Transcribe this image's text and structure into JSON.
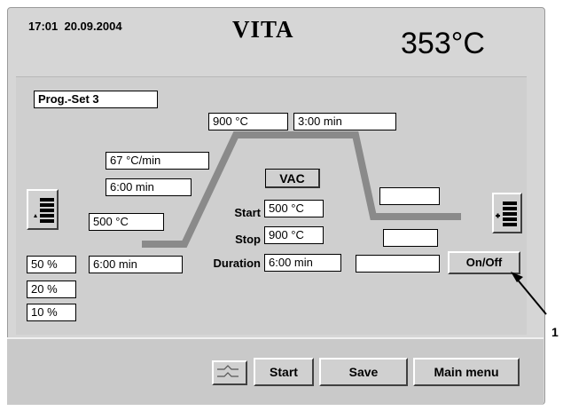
{
  "header": {
    "clock": "17:01",
    "date": "20.09.2004",
    "brand": "VITA",
    "current_temperature": "353°C"
  },
  "program": {
    "set_label": "Prog.-Set 3",
    "top_temperature": "900 °C",
    "hold_time": "3:00 min",
    "heat_rate": "67 °C/min",
    "heat_time": "6:00 min",
    "start_temperature": "500 °C",
    "predry_time": "6:00 min",
    "cool_box_1": "",
    "cool_box_2": "",
    "cool_box_3": "",
    "percent_options": [
      "50 %",
      "20 %",
      "10 %"
    ]
  },
  "vacuum": {
    "button_label": "VAC",
    "start_label": "Start",
    "start_value": "500 °C",
    "stop_label": "Stop",
    "stop_value": "900 °C",
    "duration_label": "Duration",
    "duration_value": "6:00 min"
  },
  "onoff_label": "On/Off",
  "callout_number": "1",
  "footer": {
    "start_label": "Start",
    "save_label": "Save",
    "main_menu_label": "Main menu"
  },
  "icons": [
    "lift-down-icon",
    "lift-up-icon",
    "cooling-icon"
  ],
  "colors": {
    "background": "#d6d6d6",
    "curve": "#8a8a8a",
    "box": "#ffffff"
  }
}
